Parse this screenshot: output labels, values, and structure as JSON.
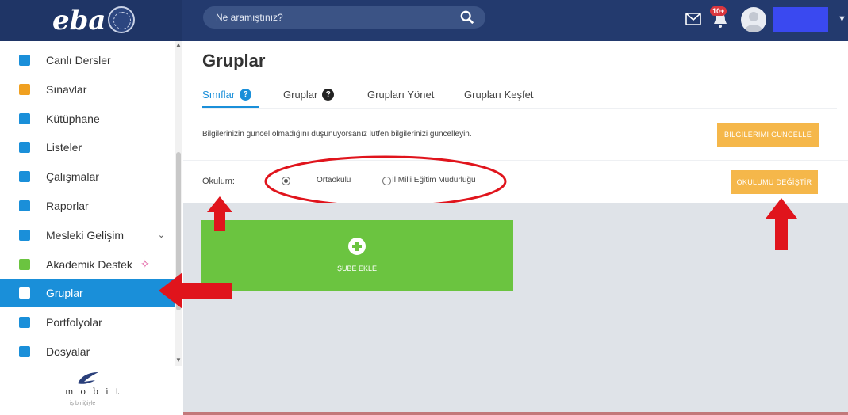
{
  "header": {
    "logo_text": "eba",
    "search_placeholder": "Ne aramıştınız?",
    "notification_badge": "10+"
  },
  "sidebar": {
    "items": [
      {
        "label": "Canlı Dersler",
        "icon": "video-icon",
        "color": "#1a8fd9"
      },
      {
        "label": "Sınavlar",
        "icon": "pencil-icon",
        "color": "#f0a020"
      },
      {
        "label": "Kütüphane",
        "icon": "book-icon",
        "color": "#1a8fd9"
      },
      {
        "label": "Listeler",
        "icon": "list-icon",
        "color": "#1a8fd9"
      },
      {
        "label": "Çalışmalar",
        "icon": "search-list-icon",
        "color": "#1a8fd9"
      },
      {
        "label": "Raporlar",
        "icon": "pie-chart-icon",
        "color": "#1a8fd9"
      },
      {
        "label": "Mesleki Gelişim",
        "icon": "graduation-cap-icon",
        "color": "#1a8fd9"
      },
      {
        "label": "Akademik Destek",
        "icon": "bar-chart-icon",
        "color": "#6bc440"
      },
      {
        "label": "Gruplar",
        "icon": "users-icon",
        "color": "#ffffff"
      },
      {
        "label": "Portfolyolar",
        "icon": "user-folder-icon",
        "color": "#1a8fd9"
      },
      {
        "label": "Dosyalar",
        "icon": "folder-icon",
        "color": "#1a8fd9"
      }
    ],
    "active_index": 8,
    "footer_brand": "mobit",
    "footer_sub": "iş birliğiyle"
  },
  "main": {
    "title": "Gruplar",
    "tabs": [
      {
        "label": "Sınıflar",
        "has_help": true,
        "active": true
      },
      {
        "label": "Gruplar",
        "has_help": true,
        "active": false
      },
      {
        "label": "Grupları Yönet",
        "has_help": false,
        "active": false
      },
      {
        "label": "Grupları Keşfet",
        "has_help": false,
        "active": false
      }
    ],
    "info_text": "Bilgilerinizin güncel olmadığını düşünüyorsanız lütfen bilgilerinizi güncelleyin.",
    "update_button": "BİLGİLERİMİ GÜNCELLE",
    "school_label": "Okulum:",
    "school_options": [
      {
        "label": "Ortaokulu",
        "selected": true
      },
      {
        "label": "İl Milli Eğitim Müdürlüğü",
        "selected": false
      }
    ],
    "change_button": "OKULUMU DEĞİŞTİR",
    "add_card_label": "ŞUBE EKLE"
  },
  "colors": {
    "header_bg": "#233a6e",
    "accent_blue": "#1a8fd9",
    "orange_button": "#f5b74a",
    "green_card": "#6bc440",
    "annotation_red": "#e0141c"
  }
}
